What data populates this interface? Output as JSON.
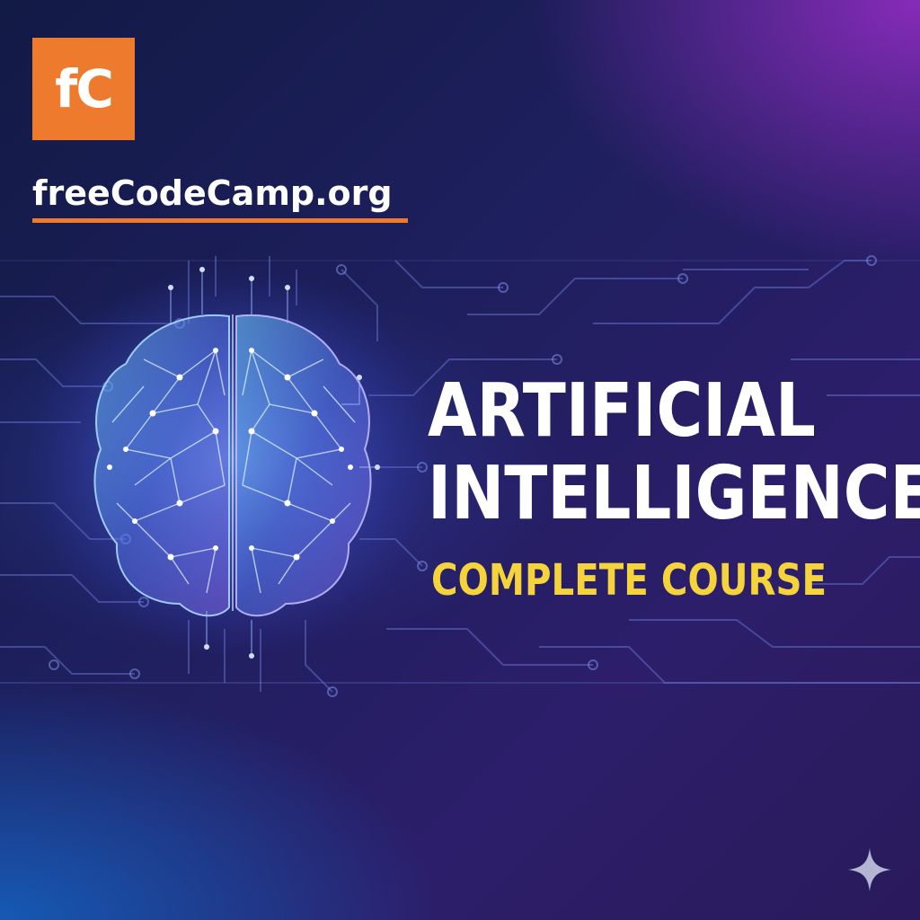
{
  "logo": {
    "letters": "fC",
    "color": "#ee7a2d"
  },
  "brand": {
    "name": "freeCodeCamp.org",
    "underline_color": "#ee7a2d"
  },
  "headline": {
    "line1": "ARTIFICIAL",
    "line2": "INTELLIGENCE"
  },
  "subheadline": {
    "text": "COMPLETE COURSE",
    "color": "#f5d33a"
  },
  "illustration": {
    "icon": "brain-network-icon"
  },
  "corner_mark": {
    "icon": "sparkle-icon"
  }
}
